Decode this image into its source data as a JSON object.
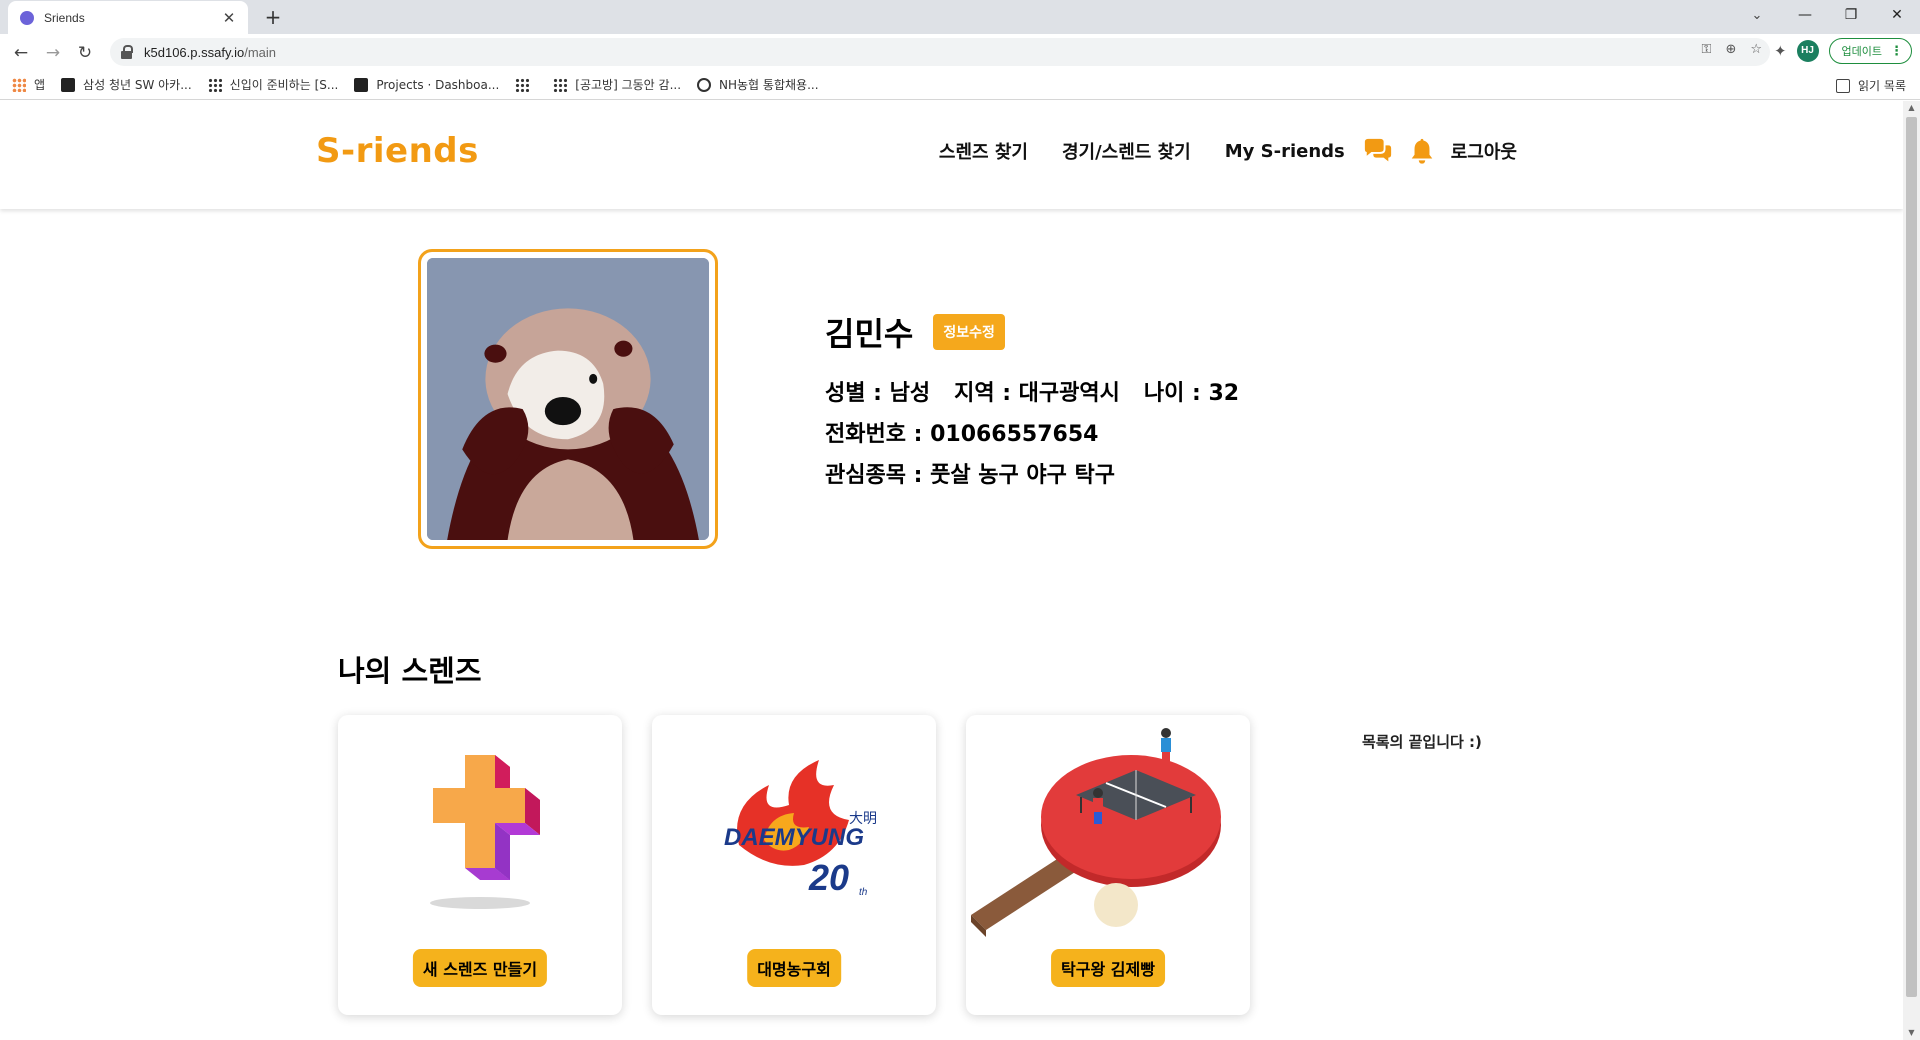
{
  "browser": {
    "tab_title": "Sriends",
    "tab_close": "✕",
    "new_tab": "+",
    "url_host": "k5d106.p.ssafy.io",
    "url_path": "/main",
    "avatar_initials": "HJ",
    "update_label": "업데이트",
    "bookmarks": [
      {
        "label": "앱",
        "icon": "apps-icon"
      },
      {
        "label": "삼성 청년 SW 아카...",
        "icon": "square-icon"
      },
      {
        "label": "신입이 준비하는 [S...",
        "icon": "dots-icon"
      },
      {
        "label": "Projects · Dashboa...",
        "icon": "square-icon"
      },
      {
        "label": "",
        "icon": "dots-icon"
      },
      {
        "label": "[공고방] 그동안 감...",
        "icon": "dots-icon"
      },
      {
        "label": "NH농협 통합채용...",
        "icon": "globe-icon"
      }
    ],
    "reading_list": "읽기 목록"
  },
  "site": {
    "logo": "S-riends",
    "nav": {
      "find_friends": "스렌즈 찾기",
      "find_match": "경기/스렌드 찾기",
      "my_sriends": "My S-riends",
      "logout": "로그아웃"
    },
    "colors": {
      "accent": "#f29a13",
      "button": "#f5a81c"
    }
  },
  "profile": {
    "name": "김민수",
    "edit_label": "정보수정",
    "gender": "성별 : 남성",
    "region": "지역 : 대구광역시",
    "age": "나이 : 32",
    "phone": "전화번호 : 01066557654",
    "interests": "관심종목 : 풋살 농구 야구 탁구"
  },
  "my_sriends": {
    "title": "나의 스렌즈",
    "cards": [
      {
        "label": "새 스렌즈 만들기",
        "icon": "plus-icon"
      },
      {
        "label": "대명농구회",
        "icon": "daemyung-logo"
      },
      {
        "label": "탁구왕 김제빵",
        "icon": "ping-pong-image"
      }
    ],
    "end_note": "목록의 끝입니다 :)"
  }
}
